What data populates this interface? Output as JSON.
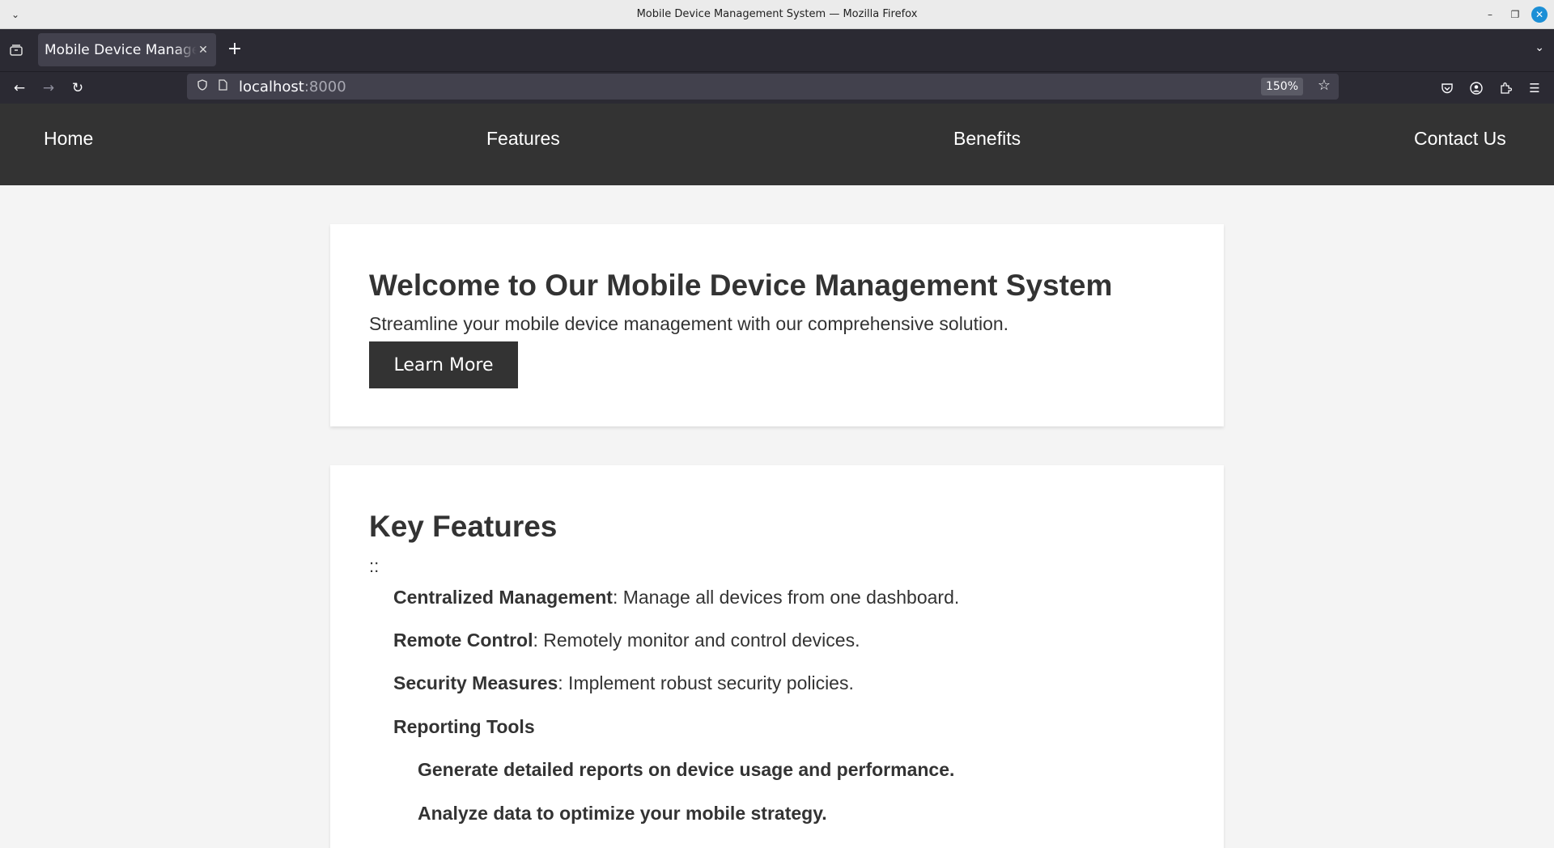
{
  "browser": {
    "window_title": "Mobile Device Management System — Mozilla Firefox",
    "tab_title": "Mobile Device Management System",
    "url_host": "localhost",
    "url_port": ":8000",
    "zoom": "150%"
  },
  "nav": {
    "home": "Home",
    "features": "Features",
    "benefits": "Benefits",
    "contact": "Contact Us"
  },
  "hero": {
    "heading": "Welcome to Our Mobile Device Management System",
    "subtitle": "Streamline your mobile device management with our comprehensive solution.",
    "button": "Learn More"
  },
  "features": {
    "heading": "Key Features",
    "stray": "::",
    "items": [
      {
        "title": "Centralized Management",
        "desc": ": Manage all devices from one dashboard."
      },
      {
        "title": "Remote Control",
        "desc": ": Remotely monitor and control devices."
      },
      {
        "title": "Security Measures",
        "desc": ": Implement robust security policies."
      },
      {
        "title": "Reporting Tools",
        "desc": ""
      }
    ],
    "sub_items": [
      "Generate detailed reports on device usage and performance.",
      "Analyze data to optimize your mobile strategy."
    ]
  },
  "icons": {
    "title_menu": "chevron-down-icon",
    "tabs_list": "tab-list-icon",
    "back": "back-arrow-icon",
    "forward": "forward-arrow-icon",
    "reload": "reload-icon",
    "shield": "tracking-shield-icon",
    "page": "page-icon",
    "bookmark": "star-icon",
    "pocket": "pocket-icon",
    "account": "account-icon",
    "extensions": "extensions-icon",
    "menu": "hamburger-menu-icon"
  },
  "colors": {
    "site_header": "#333333",
    "page_bg": "#f4f4f4",
    "card_bg": "#ffffff",
    "button_bg": "#333333",
    "browser_chrome": "#2b2a33"
  }
}
